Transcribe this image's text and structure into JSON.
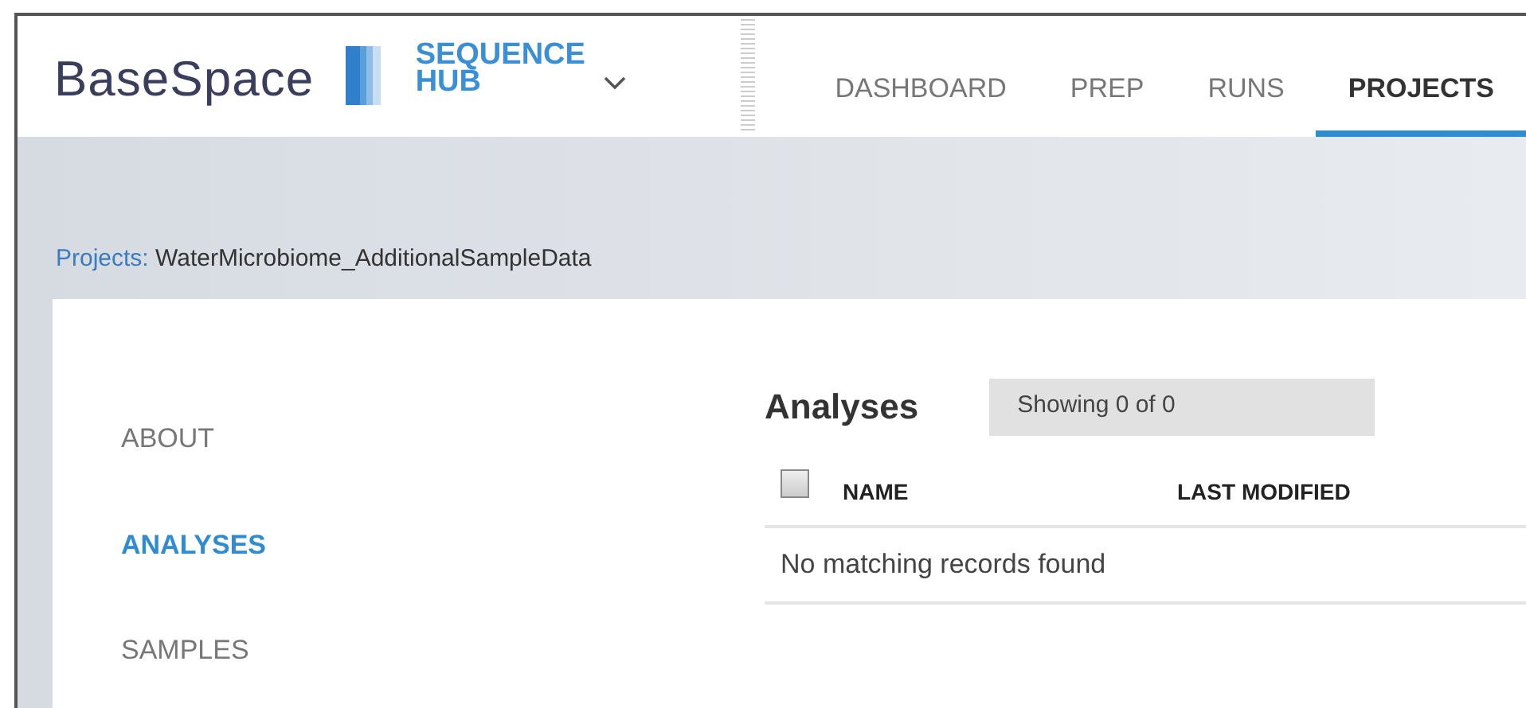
{
  "brand": {
    "name": "BaseSpace",
    "product_line_1": "SEQUENCE",
    "product_line_2": "HUB"
  },
  "nav_tabs": [
    {
      "label": "DASHBOARD",
      "selected": false
    },
    {
      "label": "PREP",
      "selected": false
    },
    {
      "label": "RUNS",
      "selected": false
    },
    {
      "label": "PROJECTS",
      "selected": true
    }
  ],
  "breadcrumb": {
    "label": "Projects:",
    "current": "WaterMicrobiome_AdditionalSampleData"
  },
  "sidebar": {
    "items": [
      {
        "label": "ABOUT",
        "selected": false
      },
      {
        "label": "ANALYSES",
        "selected": true
      },
      {
        "label": "SAMPLES",
        "selected": false
      }
    ]
  },
  "analyses": {
    "title": "Analyses",
    "count_text": "Showing 0 of 0",
    "select_all": {
      "checked": false
    },
    "columns": [
      "NAME",
      "LAST MODIFIED"
    ],
    "empty_message": "No matching records found"
  }
}
